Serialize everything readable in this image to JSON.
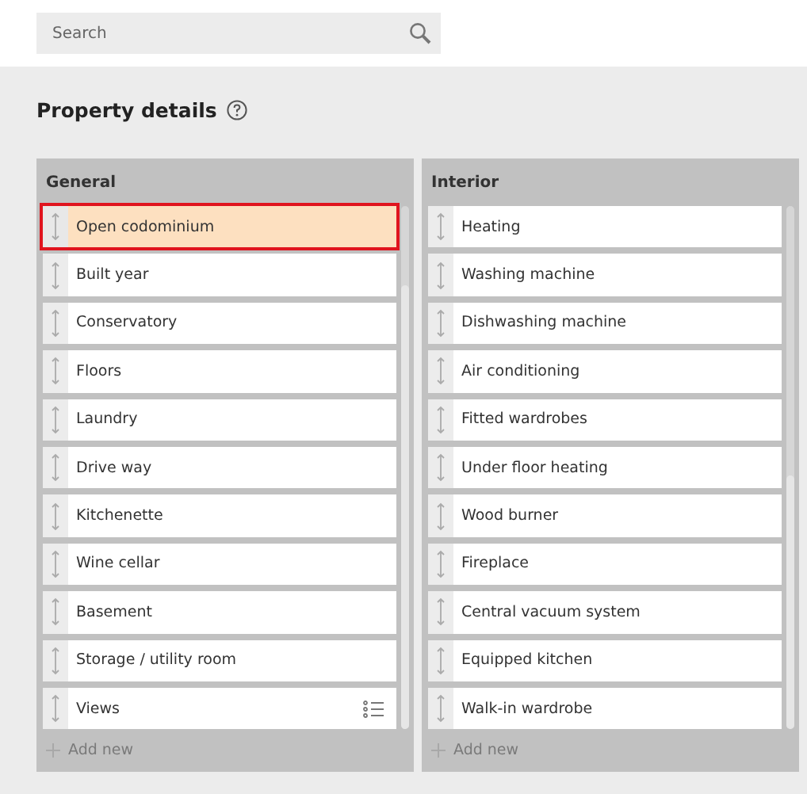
{
  "search": {
    "placeholder": "Search"
  },
  "section": {
    "title": "Property details"
  },
  "panels": [
    {
      "title": "General",
      "add_label": "Add new",
      "items": [
        {
          "label": "Open codominium",
          "selected": true,
          "kind": "plain"
        },
        {
          "label": "Built year",
          "selected": false,
          "kind": "plain"
        },
        {
          "label": "Conservatory",
          "selected": false,
          "kind": "plain"
        },
        {
          "label": "Floors",
          "selected": false,
          "kind": "plain"
        },
        {
          "label": "Laundry",
          "selected": false,
          "kind": "plain"
        },
        {
          "label": "Drive way",
          "selected": false,
          "kind": "plain"
        },
        {
          "label": "Kitchenette",
          "selected": false,
          "kind": "plain"
        },
        {
          "label": "Wine cellar",
          "selected": false,
          "kind": "plain"
        },
        {
          "label": "Basement",
          "selected": false,
          "kind": "plain"
        },
        {
          "label": "Storage / utility room",
          "selected": false,
          "kind": "plain"
        },
        {
          "label": "Views",
          "selected": false,
          "kind": "options"
        }
      ]
    },
    {
      "title": "Interior",
      "add_label": "Add new",
      "items": [
        {
          "label": "Heating",
          "selected": false,
          "kind": "plain"
        },
        {
          "label": "Washing machine",
          "selected": false,
          "kind": "plain"
        },
        {
          "label": "Dishwashing machine",
          "selected": false,
          "kind": "plain"
        },
        {
          "label": "Air conditioning",
          "selected": false,
          "kind": "plain"
        },
        {
          "label": "Fitted wardrobes",
          "selected": false,
          "kind": "plain"
        },
        {
          "label": "Under floor heating",
          "selected": false,
          "kind": "plain"
        },
        {
          "label": "Wood burner",
          "selected": false,
          "kind": "plain"
        },
        {
          "label": "Fireplace",
          "selected": false,
          "kind": "plain"
        },
        {
          "label": "Central vacuum system",
          "selected": false,
          "kind": "plain"
        },
        {
          "label": "Equipped kitchen",
          "selected": false,
          "kind": "plain"
        },
        {
          "label": "Walk-in wardrobe",
          "selected": false,
          "kind": "plain"
        }
      ]
    }
  ]
}
